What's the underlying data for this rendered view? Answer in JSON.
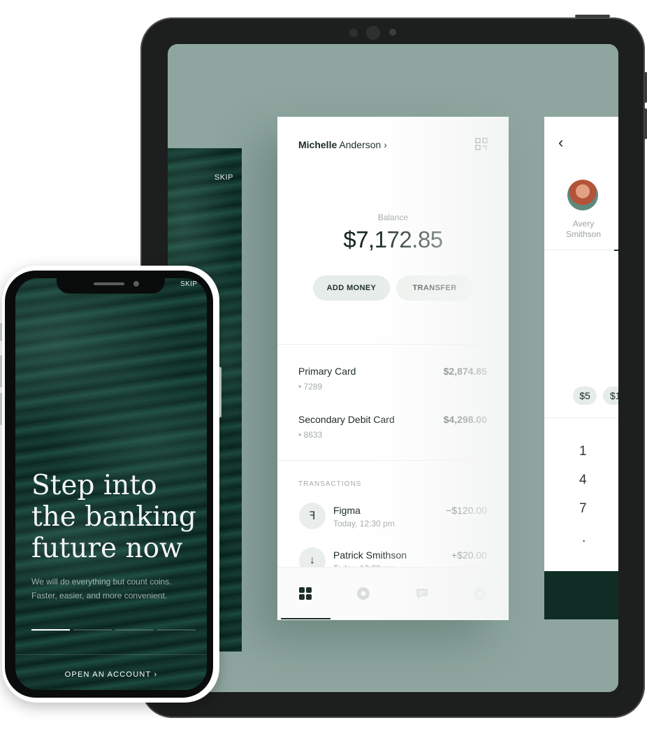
{
  "tablet": {
    "left_screen": {
      "skip_label": "SKIP"
    },
    "wallet": {
      "user_first": "Michelle",
      "user_last": "Anderson",
      "user_chevron": "›",
      "balance_label": "Balance",
      "balance_value": "$7,172.85",
      "add_money_label": "ADD MONEY",
      "transfer_label": "TRANSFER",
      "cards": [
        {
          "name": "Primary Card",
          "number": "• 7289",
          "amount": "$2,874.85"
        },
        {
          "name": "Secondary Debit Card",
          "number": "• 8633",
          "amount": "$4,298.00"
        }
      ],
      "transactions_header": "TRANSACTIONS",
      "transactions": [
        {
          "icon": "figma-icon",
          "glyph": "ꟻ",
          "name": "Figma",
          "time": "Today, 12:30 pm",
          "amount": "−$120.00"
        },
        {
          "icon": "arrow-down-icon",
          "glyph": "↓",
          "name": "Patrick Smithson",
          "time": "Today, 12:30 pm",
          "amount": "+$20.00"
        }
      ],
      "tabs": [
        "dashboard-icon",
        "circle-icon",
        "chat-icon",
        "settings-icon"
      ]
    },
    "transfer_screen": {
      "back_glyph": "‹",
      "contact_first": "Avery",
      "contact_last": "Smithson",
      "chips": [
        "$5",
        "$1"
      ],
      "keys": [
        "1",
        "4",
        "7",
        "."
      ]
    }
  },
  "phone": {
    "skip_label": "SKIP",
    "headline_lines": [
      "Step into",
      "the banking",
      "future now"
    ],
    "subtitle_lines": [
      "We will do everything but count coins.",
      "Faster, easier, and more convenient."
    ],
    "cta_label": "OPEN AN ACCOUNT ›",
    "progress": {
      "steps": 4,
      "active": 1
    }
  },
  "colors": {
    "accent_dark": "#0f2c25",
    "tablet_bg": "#8fa6a0",
    "chip_bg": "#e6ecea"
  }
}
